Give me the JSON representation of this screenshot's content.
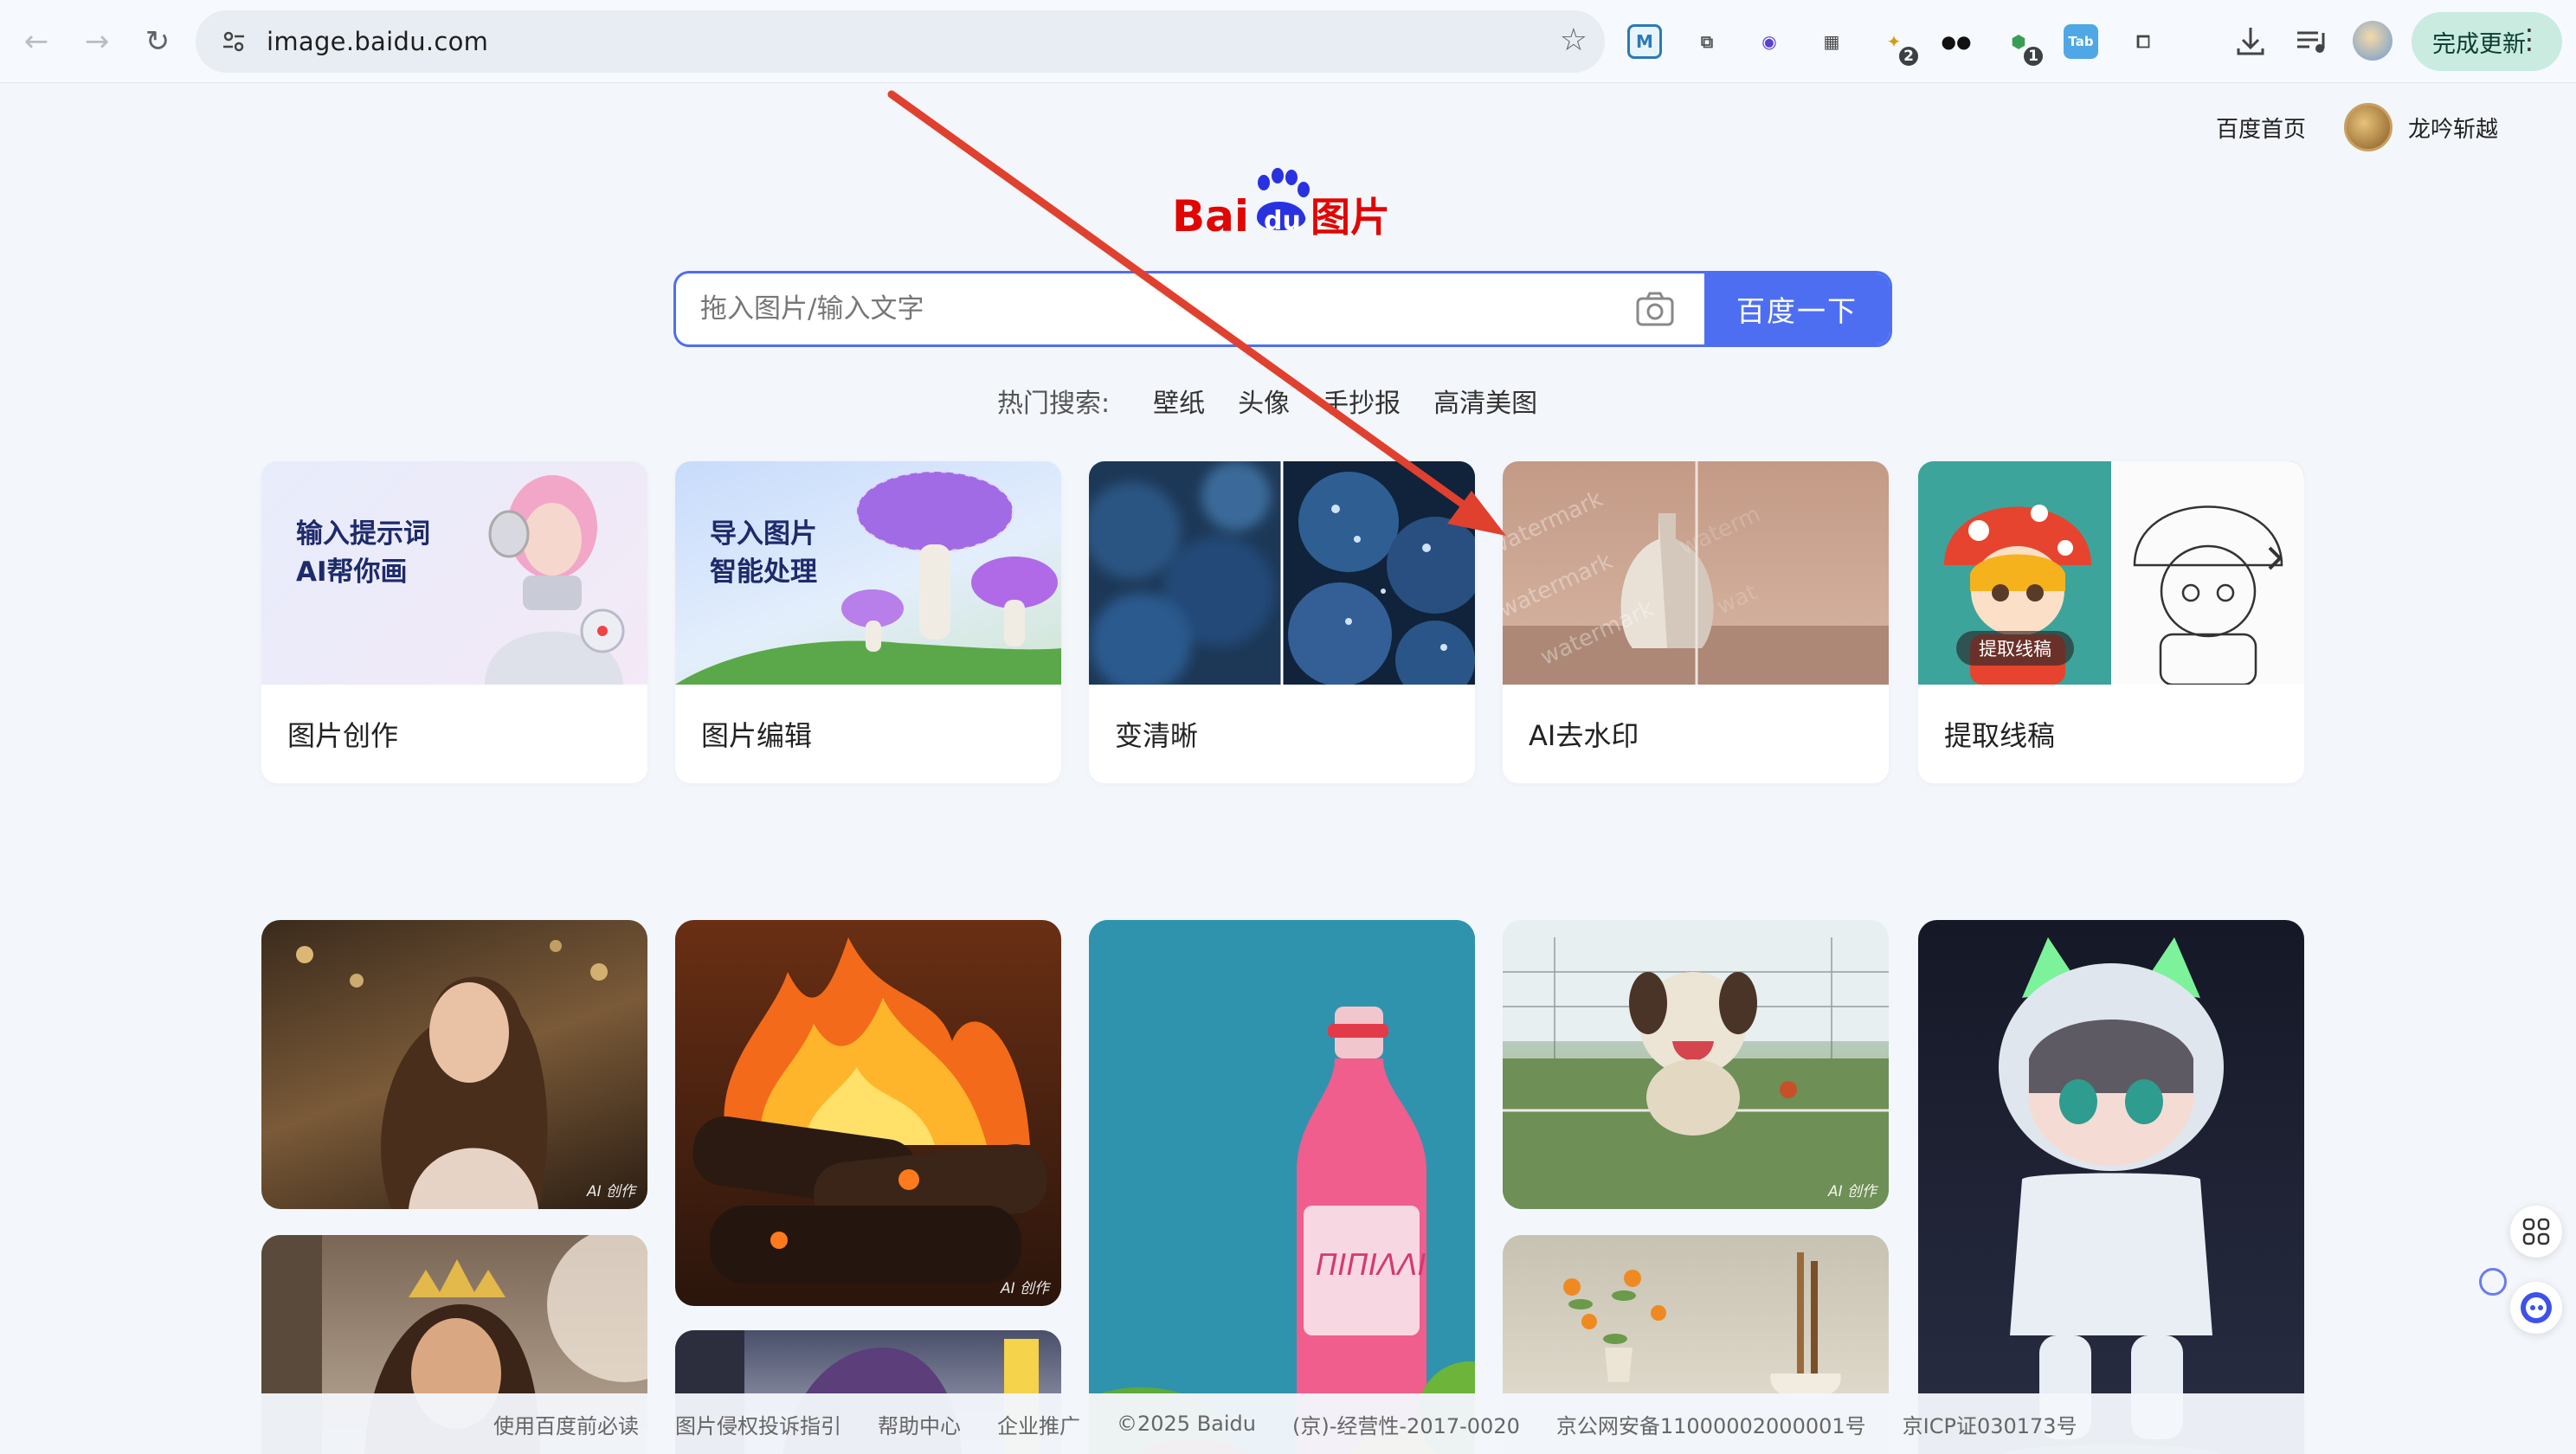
{
  "browser": {
    "url": "image.baidu.com",
    "update_label": "完成更新",
    "extensions": [
      {
        "name": "m-extension",
        "text": "M",
        "color": "#2a7ab8"
      },
      {
        "name": "copy-extension",
        "text": "⧉",
        "color": "#555"
      },
      {
        "name": "face-extension",
        "text": "◉",
        "color": "#5b3fd6"
      },
      {
        "name": "qr-extension",
        "text": "▦",
        "color": "#444"
      },
      {
        "name": "pet-extension",
        "text": "✦",
        "color": "#d89a12",
        "badge": "2"
      },
      {
        "name": "mask-extension",
        "text": "●●",
        "color": "#111"
      },
      {
        "name": "shield-extension",
        "text": "⬢",
        "color": "#3a9d57",
        "badge": "1"
      },
      {
        "name": "tab-extension",
        "text": "Tab",
        "color": "#2d8bd8"
      },
      {
        "name": "puzzle-extension",
        "text": "⧠",
        "color": "#444"
      }
    ]
  },
  "header": {
    "home_link": "百度首页",
    "username": "龙吟斩越"
  },
  "logo": {
    "bai": "Bai",
    "du": "du",
    "suffix": "图片"
  },
  "search": {
    "placeholder": "拖入图片/输入文字",
    "button": "百度一下"
  },
  "hot": {
    "label": "热门搜索:",
    "items": [
      "壁纸",
      "头像",
      "手抄报",
      "高清美图"
    ]
  },
  "tools": [
    {
      "label": "图片创作",
      "overlay": [
        "输入提示词",
        "AI帮你画"
      ]
    },
    {
      "label": "图片编辑",
      "overlay": [
        "导入图片",
        "智能处理"
      ]
    },
    {
      "label": "变清晰"
    },
    {
      "label": "AI去水印"
    },
    {
      "label": "提取线稿",
      "chip": "提取线稿"
    }
  ],
  "gallery": {
    "ai_tag": "AI 创作"
  },
  "footer": [
    "使用百度前必读",
    "图片侵权投诉指引",
    "帮助中心",
    "企业推广",
    "©2025 Baidu",
    "(京)-经营性-2017-0020",
    "京公网安备11000002000001号",
    "京ICP证030173号"
  ],
  "colors": {
    "accent": "#4e6ef2",
    "baidu_red": "#e10602",
    "arrow": "#e0412f"
  }
}
